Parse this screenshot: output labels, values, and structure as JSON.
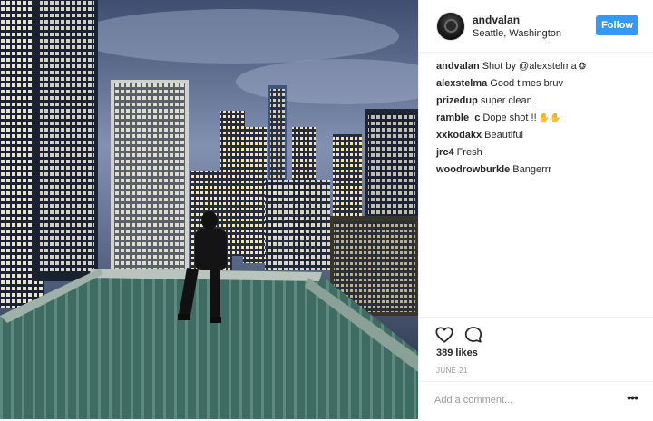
{
  "header": {
    "username": "andvalan",
    "location": "Seattle, Washington",
    "follow_label": "Follow"
  },
  "comments": [
    {
      "user": "andvalan",
      "text": "Shot by @alexstelma",
      "emoji": "❂"
    },
    {
      "user": "alexstelma",
      "text": "Good times bruv",
      "emoji": ""
    },
    {
      "user": "prizedup",
      "text": "super clean",
      "emoji": ""
    },
    {
      "user": "ramble_c",
      "text": "Dope shot !!",
      "emoji": "✋✋"
    },
    {
      "user": "xxkodakx",
      "text": "Beautiful",
      "emoji": ""
    },
    {
      "user": "jrc4",
      "text": "Fresh",
      "emoji": ""
    },
    {
      "user": "woodrowburkle",
      "text": "Bangerrr",
      "emoji": ""
    }
  ],
  "actions": {
    "like_icon": "heart-icon",
    "comment_icon": "comment-bubble-icon"
  },
  "likes_text": "389 likes",
  "date_text": "JUNE 21",
  "add_comment": {
    "placeholder": "Add a comment...",
    "more_label": "•••"
  },
  "colors": {
    "follow_button": "#3897f0",
    "divider": "#efefef",
    "muted_text": "#999999"
  }
}
